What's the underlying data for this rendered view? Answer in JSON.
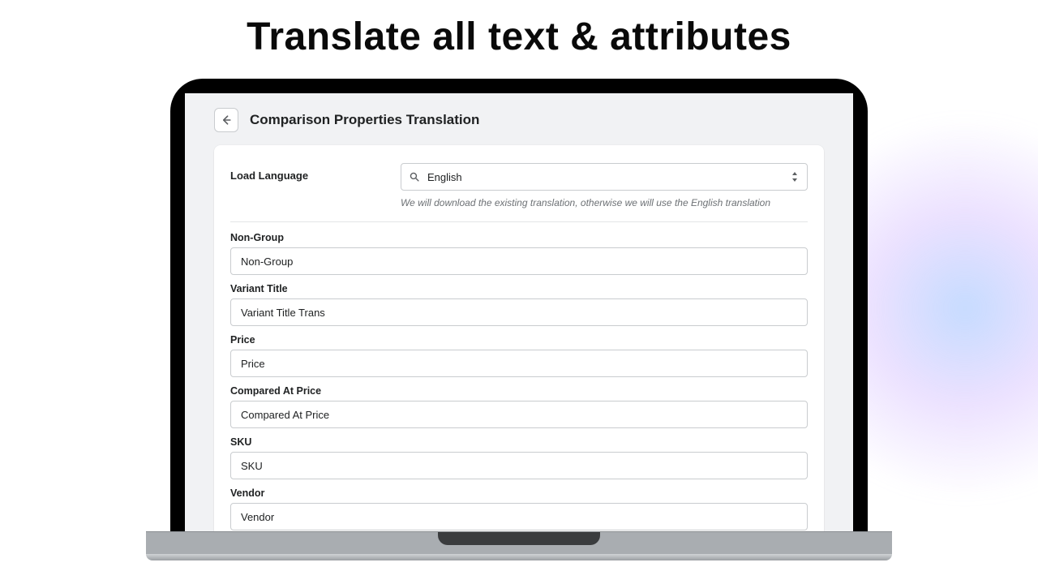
{
  "hero": {
    "title": "Translate all text & attributes"
  },
  "header": {
    "title": "Comparison Properties Translation"
  },
  "lang": {
    "label": "Load Language",
    "selected": "English",
    "helper": "We will download the existing translation, otherwise we will use the English translation"
  },
  "fields": {
    "non_group": {
      "label": "Non-Group",
      "value": "Non-Group"
    },
    "variant_title": {
      "label": "Variant Title",
      "value": "Variant Title Trans"
    },
    "price": {
      "label": "Price",
      "value": "Price"
    },
    "compared_at_price": {
      "label": "Compared At Price",
      "value": "Compared At Price"
    },
    "sku": {
      "label": "SKU",
      "value": "SKU"
    },
    "vendor": {
      "label": "Vendor",
      "value": "Vendor"
    }
  }
}
